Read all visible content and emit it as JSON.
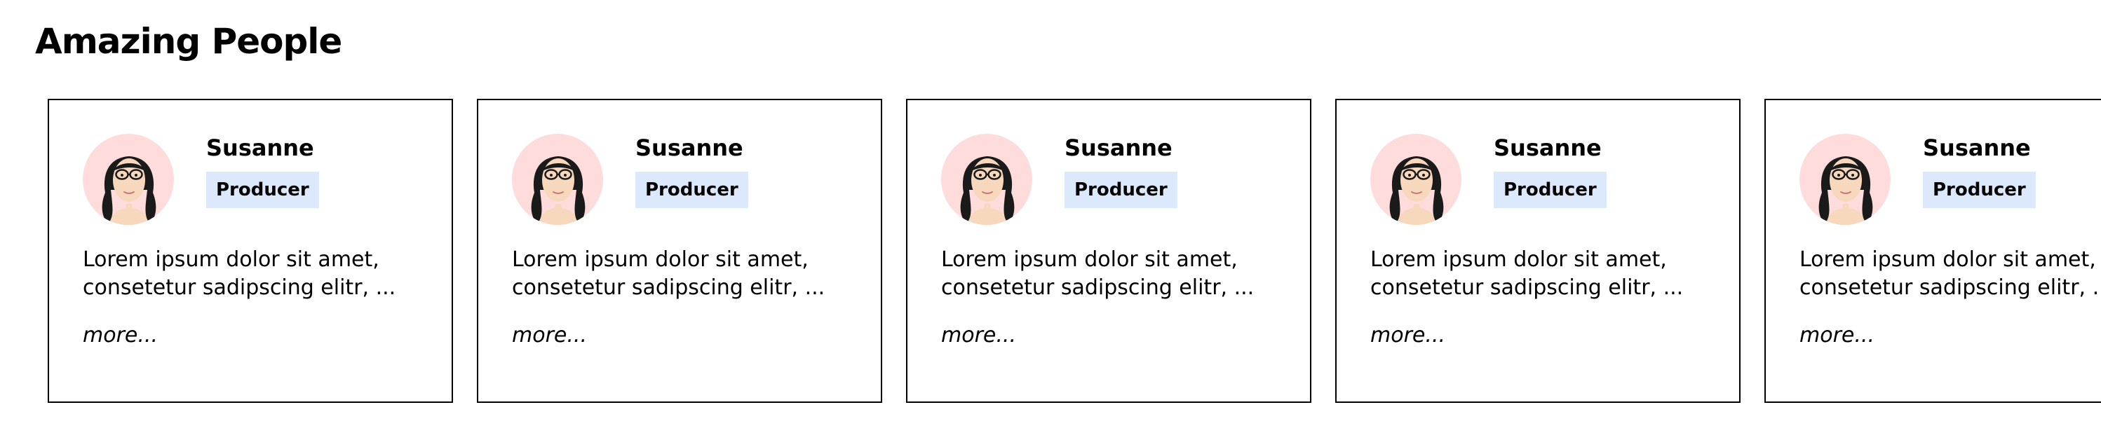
{
  "page": {
    "title": "Amazing People"
  },
  "people": [
    {
      "name": "Susanne",
      "role": "Producer",
      "description_line1": "Lorem ipsum dolor sit amet,",
      "description_line2": "consetetur sadipscing elitr, ...",
      "more_label": "more...",
      "avatar_icon": "woman-with-glasses-avatar-icon"
    },
    {
      "name": "Susanne",
      "role": "Producer",
      "description_line1": "Lorem ipsum dolor sit amet,",
      "description_line2": "consetetur sadipscing elitr, ...",
      "more_label": "more...",
      "avatar_icon": "woman-with-glasses-avatar-icon"
    },
    {
      "name": "Susanne",
      "role": "Producer",
      "description_line1": "Lorem ipsum dolor sit amet,",
      "description_line2": "consetetur sadipscing elitr, ...",
      "more_label": "more...",
      "avatar_icon": "woman-with-glasses-avatar-icon"
    },
    {
      "name": "Susanne",
      "role": "Producer",
      "description_line1": "Lorem ipsum dolor sit amet,",
      "description_line2": "consetetur sadipscing elitr, ...",
      "more_label": "more...",
      "avatar_icon": "woman-with-glasses-avatar-icon"
    },
    {
      "name": "Susanne",
      "role": "Producer",
      "description_line1": "Lorem ipsum dolor sit amet,",
      "description_line2": "consetetur sadipscing elitr, ...",
      "more_label": "more...",
      "avatar_icon": "woman-with-glasses-avatar-icon"
    }
  ],
  "colors": {
    "avatar_background": "#ffdcdc",
    "badge_background": "#dce8fc",
    "card_border": "#000000",
    "page_background": "#ffffff"
  }
}
